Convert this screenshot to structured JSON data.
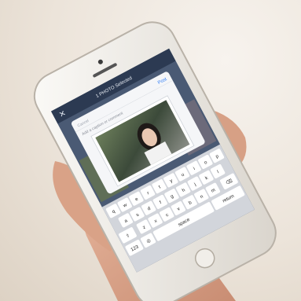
{
  "app": {
    "top_bar_title": "1 PHOTO Selected",
    "close_glyph": "✕",
    "post_label": "Post"
  },
  "compose": {
    "cancel_label": "Cancel",
    "caption_placeholder": "Add a caption or comment"
  },
  "keyboard": {
    "rows": [
      [
        "q",
        "w",
        "e",
        "r",
        "t",
        "y",
        "u",
        "i",
        "o",
        "p"
      ],
      [
        "a",
        "s",
        "d",
        "f",
        "g",
        "h",
        "j",
        "k",
        "l"
      ],
      [
        "z",
        "x",
        "c",
        "v",
        "b",
        "n",
        "m"
      ]
    ],
    "numbers_label": "123",
    "space_label": "space",
    "return_label": "return"
  },
  "colors": {
    "phone_body": "#f4f1ec",
    "screen_bg": "#3b4a63",
    "header_bg": "#2c3a52",
    "keyboard_bg": "#d2d5db",
    "accent": "#2e7cf6"
  },
  "icons": {
    "close": "close-icon",
    "shift": "shift-icon",
    "backspace": "backspace-icon",
    "globe": "globe-icon"
  }
}
